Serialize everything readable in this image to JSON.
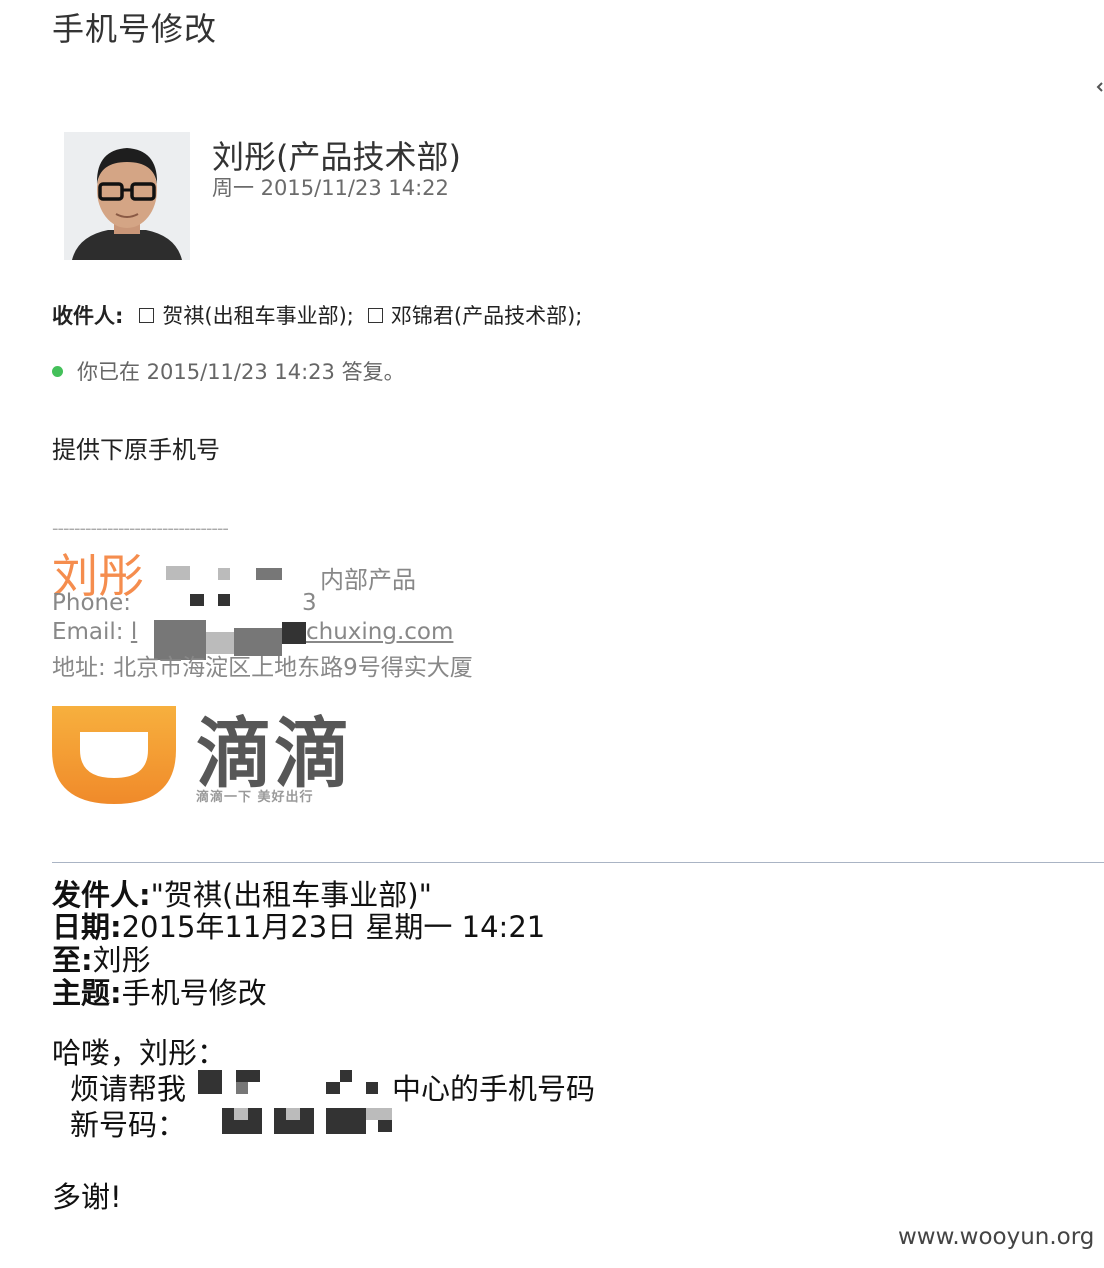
{
  "subject": "手机号修改",
  "message": {
    "sender_name": "刘彤(产品技术部)",
    "sent_time": "周一 2015/11/23 14:22",
    "recipients_label": "收件人:",
    "recipients": [
      "贺祺(出租车事业部);",
      "邓锦君(产品技术部);"
    ],
    "reply_status": "你已在 2015/11/23 14:23 答复。",
    "body": "提供下原手机号"
  },
  "signature": {
    "separator": "--------------------------------",
    "name": "刘彤",
    "dept": "内部产品",
    "phone_label": "Phone:",
    "phone_tail": "3",
    "email_label": "Email:",
    "email_head": "l",
    "email_tail": "chuxing.com",
    "address_label": "地址:",
    "address": "北京市海淀区上地东路9号得实大厦"
  },
  "logo": {
    "text": "滴滴",
    "slogan": "滴滴一下 美好出行",
    "color": "#f5a03a"
  },
  "quoted": {
    "from_label": "发件人:",
    "from_value": "\"贺祺(出租车事业部)\"",
    "date_label": "日期:",
    "date_value": "2015年11月23日 星期一 14:21",
    "to_label": "至:",
    "to_value": "刘彤",
    "subject_label": "主题:",
    "subject_value": "手机号修改",
    "greeting": "哈喽，刘彤：",
    "line1_prefix": "烦请帮我",
    "line1_suffix": "中心的手机号码",
    "line2_label": "新号码：",
    "closing": "多谢!"
  },
  "watermark": "www.wooyun.org"
}
